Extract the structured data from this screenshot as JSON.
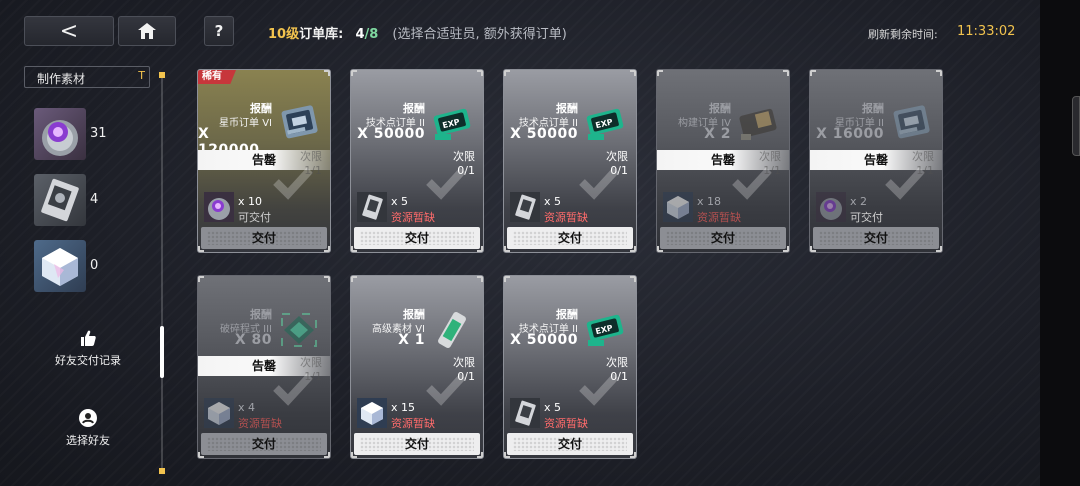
{
  "topbar": {
    "level": "10级",
    "label": "订单库:",
    "count_current": "4",
    "count_sep": "/",
    "count_max": "8",
    "hint": "(选择合适驻员, 额外获得订单)",
    "refresh_label": "刷新剩余时间:",
    "refresh_time": "11:33:02",
    "back_glyph": "<",
    "help_glyph": "?"
  },
  "sidebar": {
    "header": "制作素材",
    "header_mark": "T",
    "materials": [
      {
        "icon": "purple-disc-icon",
        "count": "31"
      },
      {
        "icon": "data-chip-icon",
        "count": "4"
      },
      {
        "icon": "crystal-cube-icon",
        "count": "0"
      }
    ],
    "actions": [
      {
        "icon": "thumbs-up-icon",
        "label": "好友交付记录"
      },
      {
        "icon": "friend-select-icon",
        "label": "选择好友"
      }
    ]
  },
  "cards": [
    {
      "rare": "稀有",
      "reward_label": "报酬",
      "reward_name": "星币订单 VI",
      "reward_qty": "X 120000",
      "reward_icon": "credit-card-icon",
      "sold": "告罄",
      "limit_label": "次限",
      "limit_value": "1/1",
      "req_icon": "purple-disc-icon",
      "req_qty": "x 10",
      "req_status": "可交付",
      "deliver": "交付",
      "state": "rare"
    },
    {
      "reward_label": "报酬",
      "reward_name": "技术点订单 II",
      "reward_qty": "X 50000",
      "reward_icon": "exp-card-icon",
      "limit_label": "次限",
      "limit_value": "0/1",
      "req_icon": "data-chip-icon",
      "req_qty": "x 5",
      "req_status": "资源暂缺",
      "deliver": "交付",
      "state": "active"
    },
    {
      "reward_label": "报酬",
      "reward_name": "技术点订单 II",
      "reward_qty": "X 50000",
      "reward_icon": "exp-card-icon",
      "limit_label": "次限",
      "limit_value": "0/1",
      "req_icon": "data-chip-icon",
      "req_qty": "x 5",
      "req_status": "资源暂缺",
      "deliver": "交付",
      "state": "active"
    },
    {
      "reward_label": "报酬",
      "reward_name": "构建订单 IV",
      "reward_qty": "X 2",
      "reward_icon": "build-ticket-icon",
      "sold": "告罄",
      "limit_label": "次限",
      "limit_value": "1/1",
      "req_icon": "crystal-cube-icon",
      "req_qty": "x 18",
      "req_status": "资源暂缺",
      "deliver": "交付",
      "state": "dim"
    },
    {
      "reward_label": "报酬",
      "reward_name": "星币订单 II",
      "reward_qty": "X 16000",
      "reward_icon": "credit-card-icon",
      "sold": "告罄",
      "limit_label": "次限",
      "limit_value": "1/1",
      "req_icon": "purple-disc-icon",
      "req_qty": "x 2",
      "req_status": "可交付",
      "deliver": "交付",
      "state": "dim"
    },
    {
      "reward_label": "报酬",
      "reward_name": "破碎程式 III",
      "reward_qty": "X 80",
      "reward_icon": "green-chip-icon",
      "sold": "告罄",
      "limit_label": "次限",
      "limit_value": "1/1",
      "req_icon": "crystal-cube-icon",
      "req_qty": "x 4",
      "req_status": "资源暂缺",
      "deliver": "交付",
      "state": "dim"
    },
    {
      "reward_label": "报酬",
      "reward_name": "高级素材 VI",
      "reward_qty": "X 1",
      "reward_icon": "battery-icon",
      "limit_label": "次限",
      "limit_value": "0/1",
      "req_icon": "crystal-cube-icon",
      "req_qty": "x 15",
      "req_status": "资源暂缺",
      "deliver": "交付",
      "state": "active"
    },
    {
      "reward_label": "报酬",
      "reward_name": "技术点订单 II",
      "reward_qty": "X 50000",
      "reward_icon": "exp-card-icon",
      "limit_label": "次限",
      "limit_value": "0/1",
      "req_icon": "data-chip-icon",
      "req_qty": "x 5",
      "req_status": "资源暂缺",
      "deliver": "交付",
      "state": "active"
    }
  ]
}
